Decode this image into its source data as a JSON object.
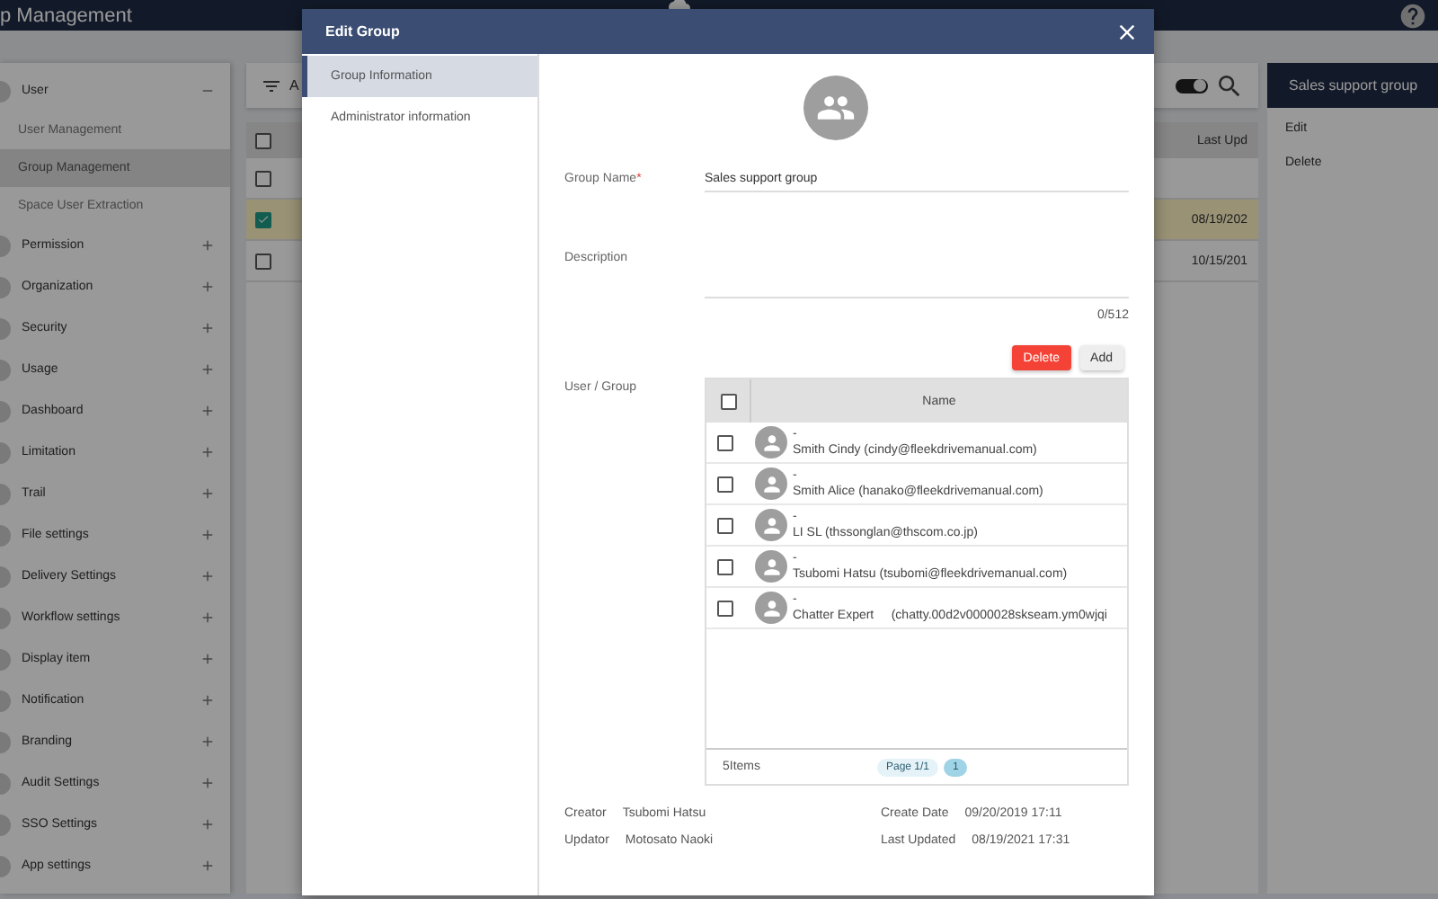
{
  "header": {
    "title": "p Management"
  },
  "sidebar": {
    "items": [
      {
        "label": "User",
        "expanded": true,
        "children": [
          {
            "label": "User Management",
            "selected": false
          },
          {
            "label": "Group Management",
            "selected": true
          },
          {
            "label": "Space User Extraction",
            "selected": false
          }
        ]
      },
      {
        "label": "Permission",
        "expanded": false
      },
      {
        "label": "Organization",
        "expanded": false
      },
      {
        "label": "Security",
        "expanded": false
      },
      {
        "label": "Usage",
        "expanded": false
      },
      {
        "label": "Dashboard",
        "expanded": false
      },
      {
        "label": "Limitation",
        "expanded": false
      },
      {
        "label": "Trail",
        "expanded": false
      },
      {
        "label": "File settings",
        "expanded": false
      },
      {
        "label": "Delivery Settings",
        "expanded": false
      },
      {
        "label": "Workflow settings",
        "expanded": false
      },
      {
        "label": "Display item",
        "expanded": false
      },
      {
        "label": "Notification",
        "expanded": false
      },
      {
        "label": "Branding",
        "expanded": false
      },
      {
        "label": "Audit Settings",
        "expanded": false
      },
      {
        "label": "SSO Settings",
        "expanded": false
      },
      {
        "label": "App settings",
        "expanded": false
      }
    ]
  },
  "list": {
    "filter_label": "A",
    "toggle_on": true,
    "all_checked": false,
    "column": "Last Upd",
    "rows": [
      {
        "checked": false,
        "selected": false
      },
      {
        "checked": true,
        "selected": true,
        "last_updated": "08/19/202"
      },
      {
        "checked": false,
        "selected": false,
        "last_updated": "10/15/201"
      }
    ]
  },
  "detail_panel": {
    "title": "Sales support group",
    "actions": [
      "Edit",
      "Delete"
    ]
  },
  "modal": {
    "title": "Edit Group",
    "tabs": [
      {
        "label": "Group Information",
        "selected": true
      },
      {
        "label": "Administrator information",
        "selected": false
      }
    ],
    "group_name": {
      "label": "Group Name",
      "required_mark": "*",
      "value": "Sales support group"
    },
    "description": {
      "label": "Description",
      "counter": "0/512"
    },
    "buttons": [
      {
        "label": "Delete",
        "kind": "danger"
      },
      {
        "label": "Add",
        "kind": "plain"
      }
    ],
    "members": {
      "label": "User / Group",
      "all_checked": false,
      "column": "Name",
      "rows": [
        {
          "subtitle": "-",
          "name": "Smith Cindy (cindy@fleekdrivemanual.com)",
          "checked": false
        },
        {
          "subtitle": "-",
          "name": "Smith Alice (hanako@fleekdrivemanual.com)",
          "checked": false
        },
        {
          "subtitle": "-",
          "name": "LI SL (thssonglan@thscom.co.jp)",
          "checked": false
        },
        {
          "subtitle": "-",
          "name": "Tsubomi Hatsu (tsubomi@fleekdrivemanual.com)",
          "checked": false
        },
        {
          "subtitle": "-",
          "name": "Chatter Expert     (chatty.00d2v0000028skseam.ym0wjqi",
          "checked": false
        }
      ],
      "count": "5Items",
      "page": "Page 1/1",
      "pages": [
        {
          "label": "1",
          "selected": true
        }
      ]
    },
    "meta": [
      {
        "label": "Creator",
        "value": "Tsubomi Hatsu"
      },
      {
        "label": "Create Date",
        "value": "09/20/2019 17:11"
      },
      {
        "label": "Updator",
        "value": "Motosato Naoki"
      },
      {
        "label": "Last Updated",
        "value": "08/19/2021 17:31"
      }
    ]
  }
}
